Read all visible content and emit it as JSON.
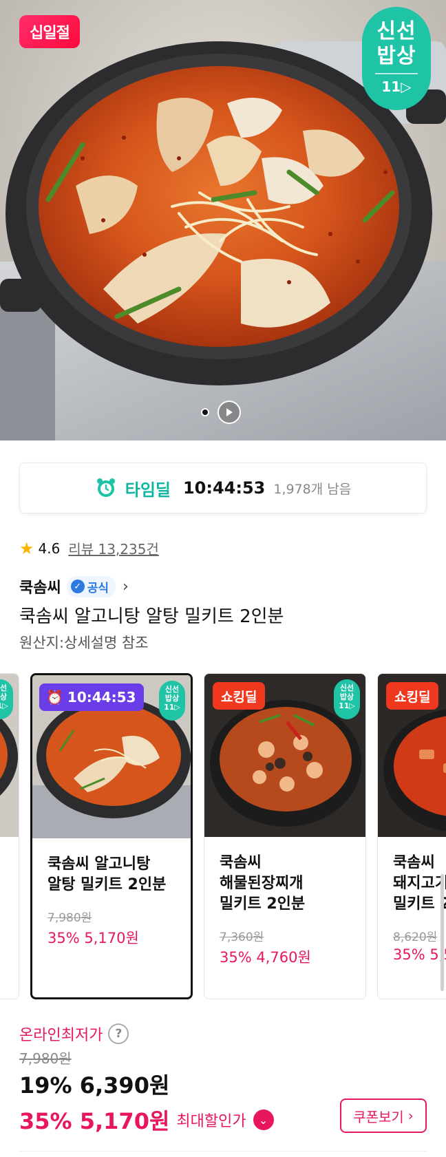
{
  "hero": {
    "event_badge": "십일절",
    "fresh_badge": {
      "line1": "신선",
      "line2": "밥상",
      "line3": "11▷"
    }
  },
  "timedeal": {
    "label": "타임딜",
    "time": "10:44:53",
    "remaining": "1,978개 남음"
  },
  "rating": {
    "score": "4.6",
    "reviews": "리뷰 13,235건"
  },
  "seller": {
    "name": "쿡솜씨",
    "official": "공식",
    "chevron": "›"
  },
  "product": {
    "title": "쿡솜씨 알고니탕 알탕 밀키트 2인분",
    "origin": "원산지:상세설명 참조"
  },
  "cards": [
    {
      "name": "쿡솜씨 알고니탕\n알탕 밀키트 2인분",
      "tag": "10:44:53",
      "orig": "7,980원",
      "sale": "35% 5,170원",
      "mini": "신선\n밥상\n11▷"
    },
    {
      "name": "쿡솜씨\n해물된장찌개\n밀키트 2인분",
      "tag": "쇼킹딜",
      "orig": "7,360원",
      "sale": "35% 4,760원",
      "mini": "신선\n밥상\n11▷"
    },
    {
      "name": "쿡솜씨\n돼지고기\n밀키트 2",
      "tag": "쇼킹딜",
      "orig": "8,620원",
      "sale": "35% 5,5"
    }
  ],
  "price": {
    "lowest_label": "온라인최저가",
    "help": "?",
    "original": "7,980원",
    "main": "19% 6,390원",
    "best_amount": "35% 5,170원",
    "best_label": "최대할인가",
    "coupon_button": "쿠폰보기",
    "coupon_chevron": "›"
  }
}
